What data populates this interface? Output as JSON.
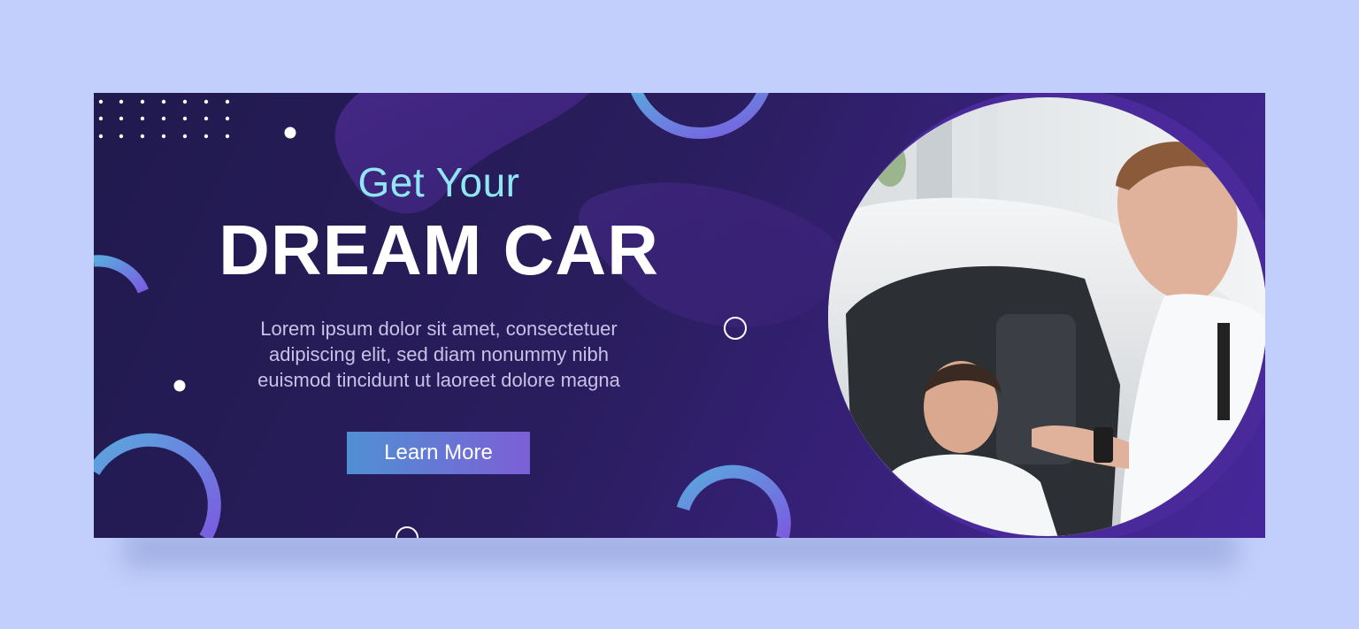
{
  "banner": {
    "headline_small": "Get Your",
    "headline_big": "DREAM CAR",
    "body_lines": [
      "Lorem ipsum dolor sit amet, consectetuer",
      "adipiscing elit, sed diam nonummy nibh",
      "euismod tincidunt ut laoreet dolore magna"
    ],
    "cta_label": "Learn More"
  },
  "colors": {
    "page_background": "#c2cffc",
    "banner_dark": "#201a4e",
    "banner_purple": "#46279a",
    "accent_cyan": "#8fe7f4",
    "button_start": "#4f90d3",
    "button_end": "#7d5fd6"
  },
  "photo": {
    "subject": "two-men-in-white-car-photo"
  }
}
